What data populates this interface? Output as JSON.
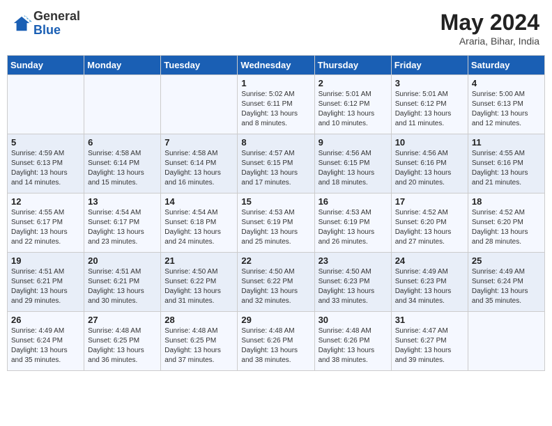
{
  "header": {
    "logo_line1": "General",
    "logo_line2": "Blue",
    "month": "May 2024",
    "location": "Araria, Bihar, India"
  },
  "weekdays": [
    "Sunday",
    "Monday",
    "Tuesday",
    "Wednesday",
    "Thursday",
    "Friday",
    "Saturday"
  ],
  "weeks": [
    [
      {
        "day": "",
        "sunrise": "",
        "sunset": "",
        "daylight": ""
      },
      {
        "day": "",
        "sunrise": "",
        "sunset": "",
        "daylight": ""
      },
      {
        "day": "",
        "sunrise": "",
        "sunset": "",
        "daylight": ""
      },
      {
        "day": "1",
        "sunrise": "Sunrise: 5:02 AM",
        "sunset": "Sunset: 6:11 PM",
        "daylight": "Daylight: 13 hours and 8 minutes."
      },
      {
        "day": "2",
        "sunrise": "Sunrise: 5:01 AM",
        "sunset": "Sunset: 6:12 PM",
        "daylight": "Daylight: 13 hours and 10 minutes."
      },
      {
        "day": "3",
        "sunrise": "Sunrise: 5:01 AM",
        "sunset": "Sunset: 6:12 PM",
        "daylight": "Daylight: 13 hours and 11 minutes."
      },
      {
        "day": "4",
        "sunrise": "Sunrise: 5:00 AM",
        "sunset": "Sunset: 6:13 PM",
        "daylight": "Daylight: 13 hours and 12 minutes."
      }
    ],
    [
      {
        "day": "5",
        "sunrise": "Sunrise: 4:59 AM",
        "sunset": "Sunset: 6:13 PM",
        "daylight": "Daylight: 13 hours and 14 minutes."
      },
      {
        "day": "6",
        "sunrise": "Sunrise: 4:58 AM",
        "sunset": "Sunset: 6:14 PM",
        "daylight": "Daylight: 13 hours and 15 minutes."
      },
      {
        "day": "7",
        "sunrise": "Sunrise: 4:58 AM",
        "sunset": "Sunset: 6:14 PM",
        "daylight": "Daylight: 13 hours and 16 minutes."
      },
      {
        "day": "8",
        "sunrise": "Sunrise: 4:57 AM",
        "sunset": "Sunset: 6:15 PM",
        "daylight": "Daylight: 13 hours and 17 minutes."
      },
      {
        "day": "9",
        "sunrise": "Sunrise: 4:56 AM",
        "sunset": "Sunset: 6:15 PM",
        "daylight": "Daylight: 13 hours and 18 minutes."
      },
      {
        "day": "10",
        "sunrise": "Sunrise: 4:56 AM",
        "sunset": "Sunset: 6:16 PM",
        "daylight": "Daylight: 13 hours and 20 minutes."
      },
      {
        "day": "11",
        "sunrise": "Sunrise: 4:55 AM",
        "sunset": "Sunset: 6:16 PM",
        "daylight": "Daylight: 13 hours and 21 minutes."
      }
    ],
    [
      {
        "day": "12",
        "sunrise": "Sunrise: 4:55 AM",
        "sunset": "Sunset: 6:17 PM",
        "daylight": "Daylight: 13 hours and 22 minutes."
      },
      {
        "day": "13",
        "sunrise": "Sunrise: 4:54 AM",
        "sunset": "Sunset: 6:17 PM",
        "daylight": "Daylight: 13 hours and 23 minutes."
      },
      {
        "day": "14",
        "sunrise": "Sunrise: 4:54 AM",
        "sunset": "Sunset: 6:18 PM",
        "daylight": "Daylight: 13 hours and 24 minutes."
      },
      {
        "day": "15",
        "sunrise": "Sunrise: 4:53 AM",
        "sunset": "Sunset: 6:19 PM",
        "daylight": "Daylight: 13 hours and 25 minutes."
      },
      {
        "day": "16",
        "sunrise": "Sunrise: 4:53 AM",
        "sunset": "Sunset: 6:19 PM",
        "daylight": "Daylight: 13 hours and 26 minutes."
      },
      {
        "day": "17",
        "sunrise": "Sunrise: 4:52 AM",
        "sunset": "Sunset: 6:20 PM",
        "daylight": "Daylight: 13 hours and 27 minutes."
      },
      {
        "day": "18",
        "sunrise": "Sunrise: 4:52 AM",
        "sunset": "Sunset: 6:20 PM",
        "daylight": "Daylight: 13 hours and 28 minutes."
      }
    ],
    [
      {
        "day": "19",
        "sunrise": "Sunrise: 4:51 AM",
        "sunset": "Sunset: 6:21 PM",
        "daylight": "Daylight: 13 hours and 29 minutes."
      },
      {
        "day": "20",
        "sunrise": "Sunrise: 4:51 AM",
        "sunset": "Sunset: 6:21 PM",
        "daylight": "Daylight: 13 hours and 30 minutes."
      },
      {
        "day": "21",
        "sunrise": "Sunrise: 4:50 AM",
        "sunset": "Sunset: 6:22 PM",
        "daylight": "Daylight: 13 hours and 31 minutes."
      },
      {
        "day": "22",
        "sunrise": "Sunrise: 4:50 AM",
        "sunset": "Sunset: 6:22 PM",
        "daylight": "Daylight: 13 hours and 32 minutes."
      },
      {
        "day": "23",
        "sunrise": "Sunrise: 4:50 AM",
        "sunset": "Sunset: 6:23 PM",
        "daylight": "Daylight: 13 hours and 33 minutes."
      },
      {
        "day": "24",
        "sunrise": "Sunrise: 4:49 AM",
        "sunset": "Sunset: 6:23 PM",
        "daylight": "Daylight: 13 hours and 34 minutes."
      },
      {
        "day": "25",
        "sunrise": "Sunrise: 4:49 AM",
        "sunset": "Sunset: 6:24 PM",
        "daylight": "Daylight: 13 hours and 35 minutes."
      }
    ],
    [
      {
        "day": "26",
        "sunrise": "Sunrise: 4:49 AM",
        "sunset": "Sunset: 6:24 PM",
        "daylight": "Daylight: 13 hours and 35 minutes."
      },
      {
        "day": "27",
        "sunrise": "Sunrise: 4:48 AM",
        "sunset": "Sunset: 6:25 PM",
        "daylight": "Daylight: 13 hours and 36 minutes."
      },
      {
        "day": "28",
        "sunrise": "Sunrise: 4:48 AM",
        "sunset": "Sunset: 6:25 PM",
        "daylight": "Daylight: 13 hours and 37 minutes."
      },
      {
        "day": "29",
        "sunrise": "Sunrise: 4:48 AM",
        "sunset": "Sunset: 6:26 PM",
        "daylight": "Daylight: 13 hours and 38 minutes."
      },
      {
        "day": "30",
        "sunrise": "Sunrise: 4:48 AM",
        "sunset": "Sunset: 6:26 PM",
        "daylight": "Daylight: 13 hours and 38 minutes."
      },
      {
        "day": "31",
        "sunrise": "Sunrise: 4:47 AM",
        "sunset": "Sunset: 6:27 PM",
        "daylight": "Daylight: 13 hours and 39 minutes."
      },
      {
        "day": "",
        "sunrise": "",
        "sunset": "",
        "daylight": ""
      }
    ]
  ]
}
